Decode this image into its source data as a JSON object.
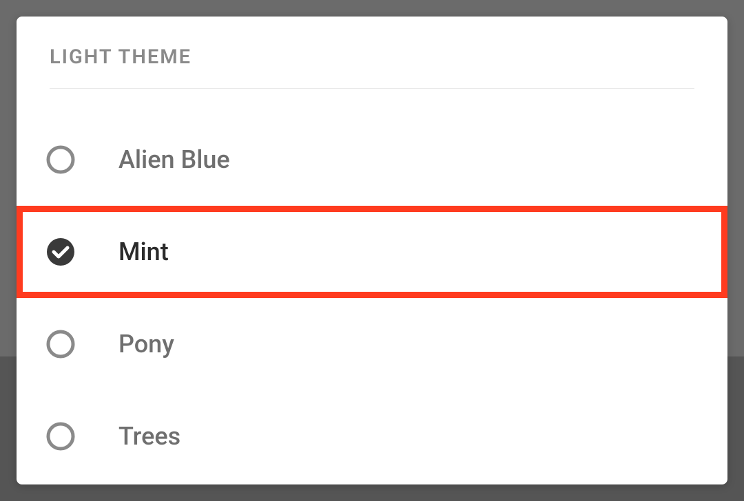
{
  "section": {
    "title": "LIGHT THEME"
  },
  "options": [
    {
      "label": "Alien Blue",
      "selected": false,
      "highlighted": false
    },
    {
      "label": "Mint",
      "selected": true,
      "highlighted": true
    },
    {
      "label": "Pony",
      "selected": false,
      "highlighted": false
    },
    {
      "label": "Trees",
      "selected": false,
      "highlighted": false
    }
  ],
  "colors": {
    "highlight": "#ff3b1f",
    "text_muted": "#6f6f6f",
    "text_strong": "#2b2b2b",
    "radio_stroke": "#8a8a8a",
    "radio_fill": "#3a3a3a"
  }
}
